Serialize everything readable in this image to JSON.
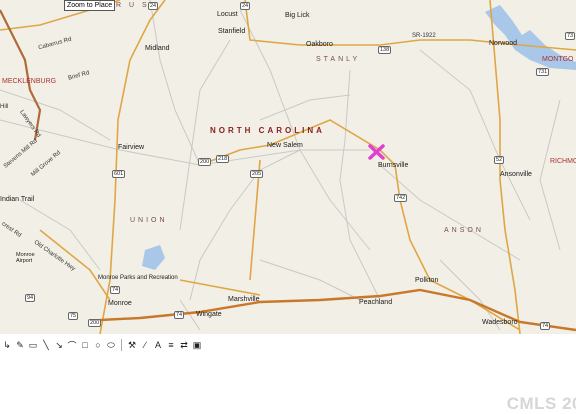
{
  "map": {
    "zoom_button": "Zoom to Place",
    "marker_color": "#e040d0",
    "colors": {
      "land": "#f2efe6",
      "highway": "#e0a646",
      "major_highway": "#c8782a",
      "road": "#c8c8c8",
      "water": "#a9c7e8",
      "marker": "#e040d0"
    },
    "state_label": "NORTH CAROLINA",
    "counties": [
      "STANLY",
      "UNION",
      "ANSON"
    ],
    "other_counties": [
      "MECKLENBURG",
      "RICHMON",
      "MONTGO"
    ],
    "towns": {
      "locust": "Locust",
      "big_lick": "Big Lick",
      "stanfield": "Stanfield",
      "oakboro": "Oakboro",
      "midland": "Midland",
      "norwood": "Norwood",
      "fairview": "Fairview",
      "new_salem": "New Salem",
      "burnsville": "Burnsville",
      "ansonville": "Ansonville",
      "indian_trail": "Indian Trail",
      "monroe": "Monroe",
      "monroe_airport": "Monroe\nAirport",
      "marshville": "Marshville",
      "wingate": "Wingate",
      "peachland": "Peachland",
      "polkton": "Polkton",
      "wadesboro": "Wadesboro",
      "rus": "R U S",
      "parks": "Monroe Parks and Recreation"
    },
    "roads": {
      "sr1922": "SR-1922",
      "cabarrus_rd": "Cabarrus Rd",
      "brief_rd": "Brief Rd",
      "lawyers_rd": "Lawyers Rd",
      "stevens_mill_rd": "Stevens Mill Rd",
      "mill_grove_rd": "Mill Grove Rd",
      "old_charlotte_hwy": "Old Charlotte Hwy",
      "secrest_rd": "crest Rd",
      "hill": "Hill"
    },
    "shields": [
      "24",
      "24",
      "138",
      "73",
      "601",
      "200",
      "218",
      "205",
      "742",
      "52",
      "74",
      "75",
      "200",
      "74",
      "74",
      "94",
      "731"
    ]
  },
  "toolbar": {
    "tools": [
      "select-arrow",
      "pencil",
      "eraser",
      "line",
      "arrow",
      "freeform",
      "rectangle",
      "circle",
      "fill",
      "text",
      "line-style"
    ]
  },
  "watermark": "CMLS 20"
}
